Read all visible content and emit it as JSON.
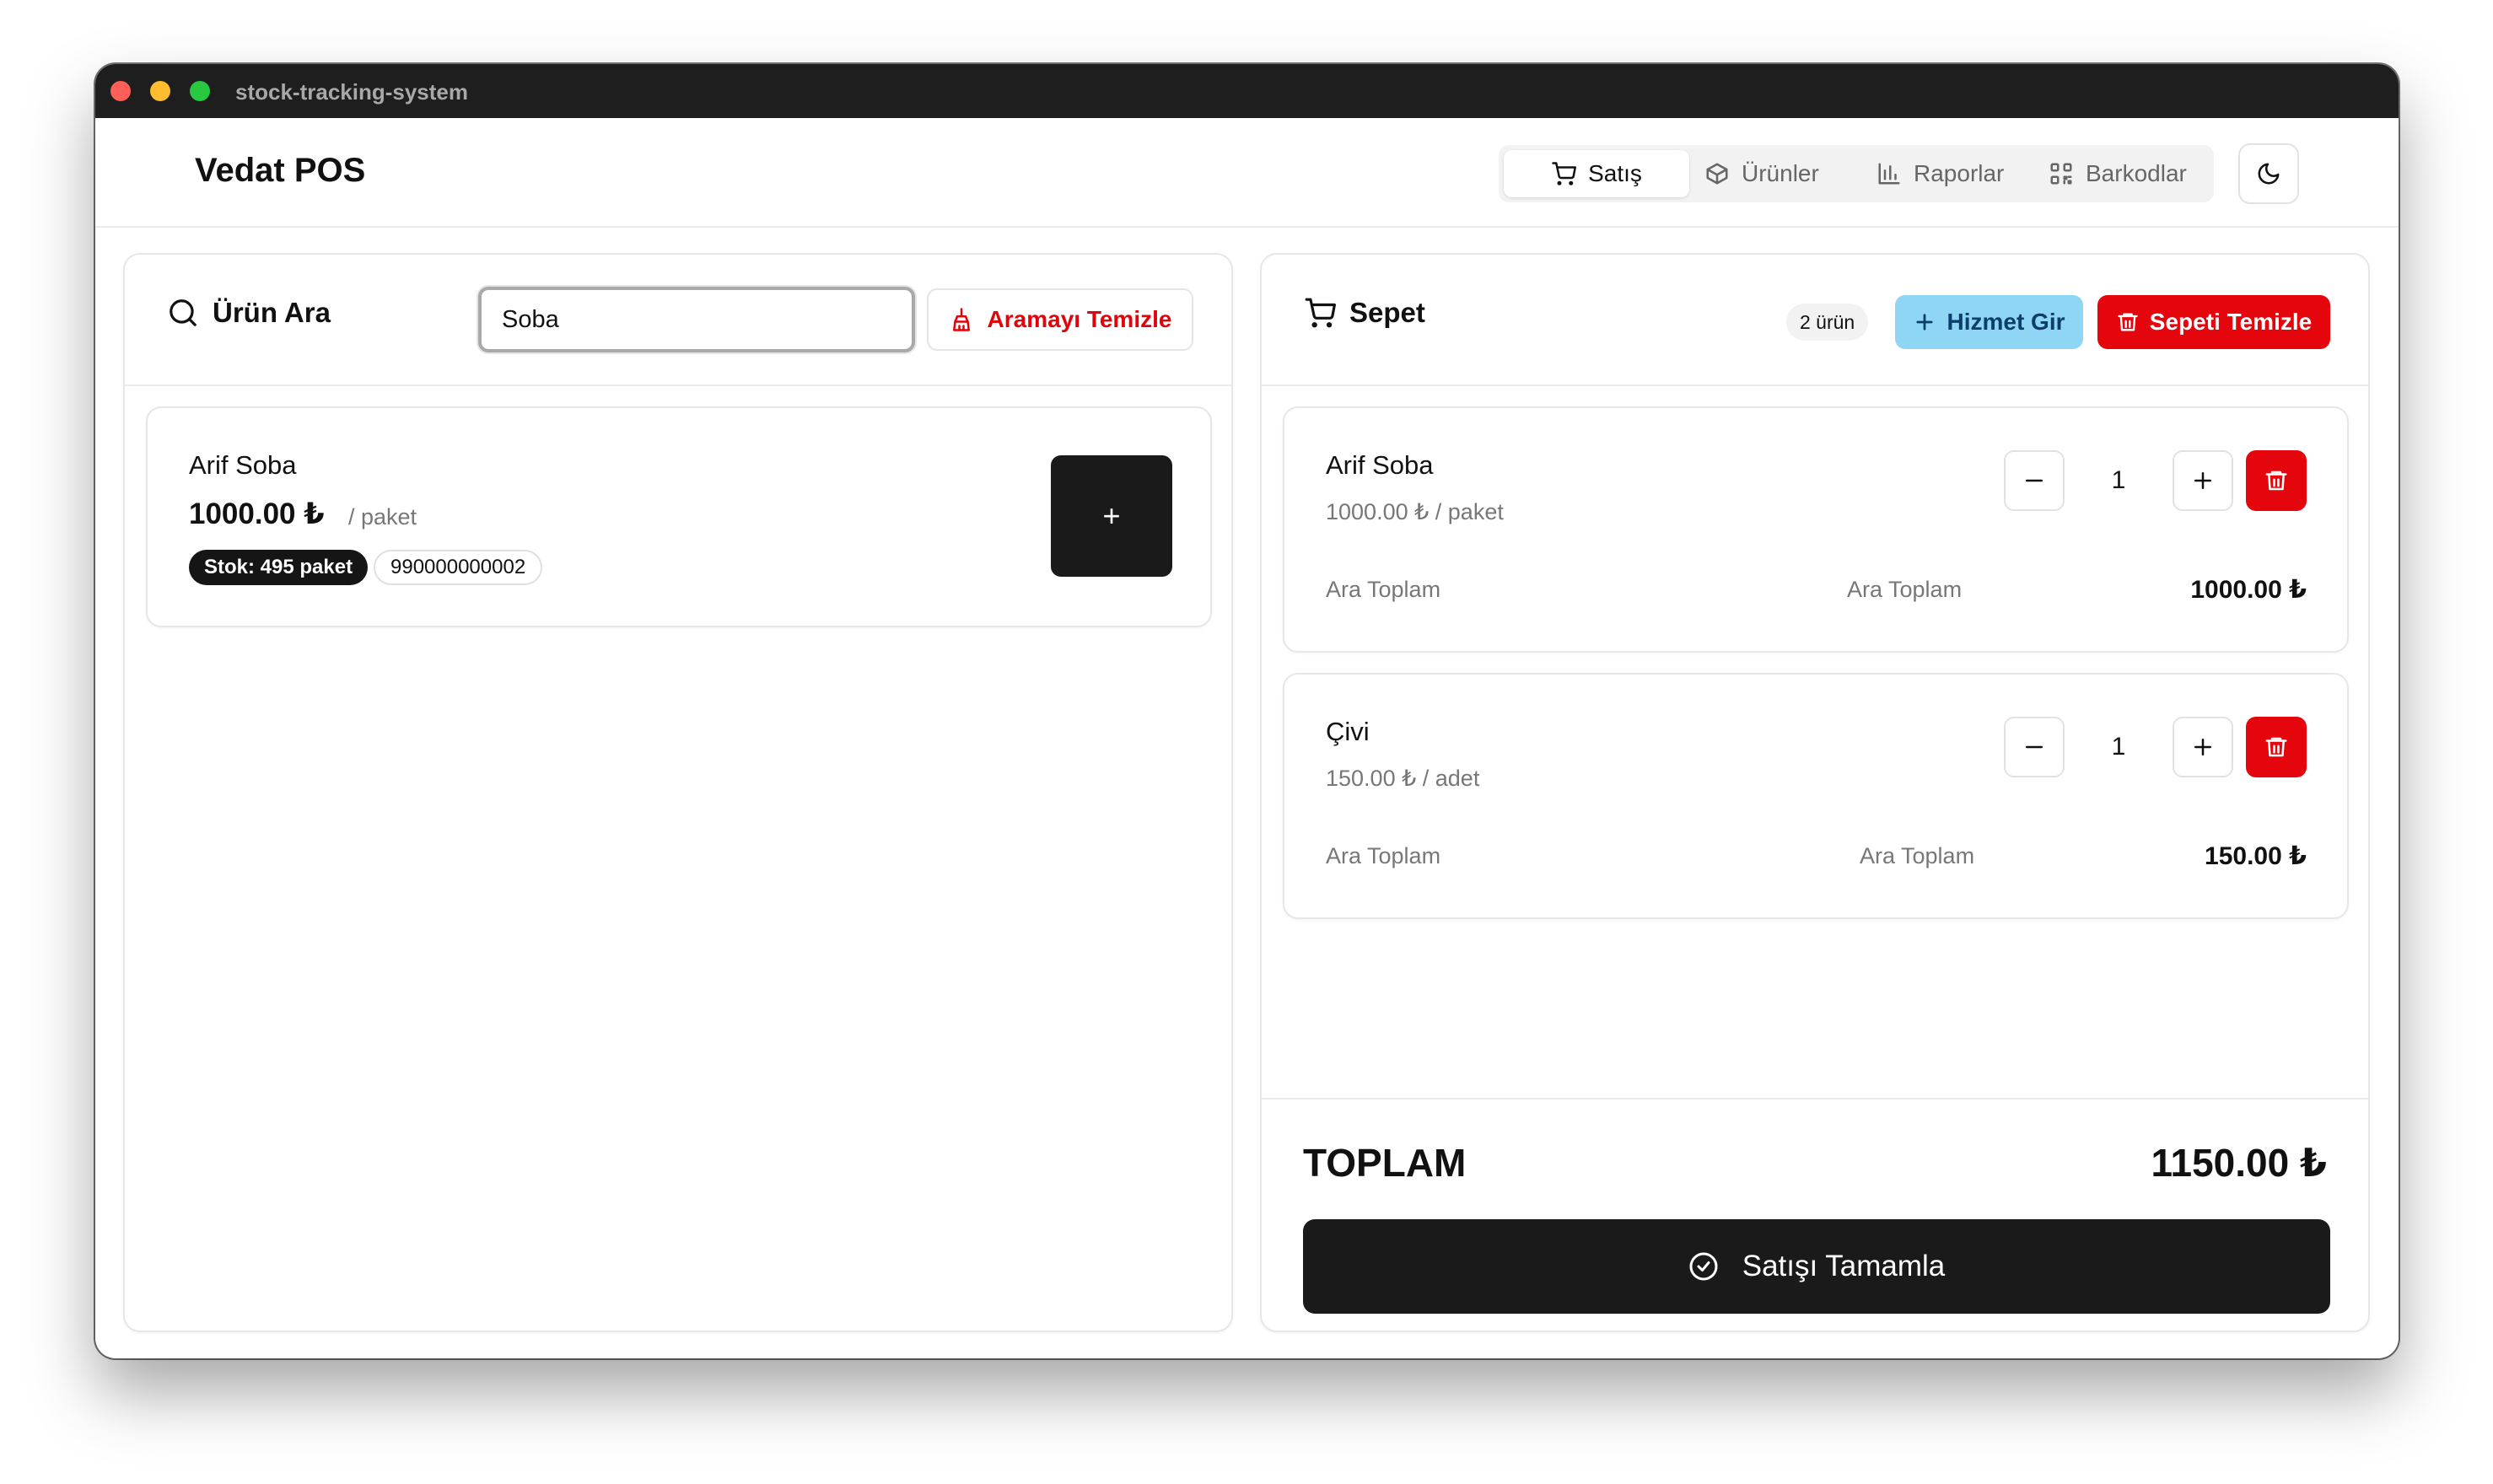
{
  "window": {
    "title": "stock-tracking-system"
  },
  "header": {
    "brand": "Vedat POS",
    "nav": [
      {
        "label": "Satış",
        "icon": "cart-icon",
        "active": true
      },
      {
        "label": "Ürünler",
        "icon": "box-icon",
        "active": false
      },
      {
        "label": "Raporlar",
        "icon": "bar-chart-icon",
        "active": false
      },
      {
        "label": "Barkodlar",
        "icon": "qr-code-icon",
        "active": false
      }
    ],
    "theme_icon": "moon-icon"
  },
  "search": {
    "title": "Ürün Ara",
    "value": "Soba",
    "clear_label": "Aramayı Temizle"
  },
  "results": [
    {
      "name": "Arif Soba",
      "price": "1000.00 ₺",
      "unit": "/ paket",
      "stock": "Stok: 495 paket",
      "barcode": "990000000002",
      "add_label": "+"
    }
  ],
  "cart": {
    "title": "Sepet",
    "count": "2 ürün",
    "service_label": "Hizmet Gir",
    "clear_label": "Sepeti Temizle",
    "items": [
      {
        "name": "Arif Soba",
        "unit_price": "1000.00 ₺ / paket",
        "qty": "1",
        "subtotal_label": "Ara Toplam",
        "subtotal_label_2": "Ara Toplam",
        "subtotal": "1000.00 ₺"
      },
      {
        "name": "Çivi",
        "unit_price": "150.00 ₺ / adet",
        "qty": "1",
        "subtotal_label": "Ara Toplam",
        "subtotal_label_2": "Ara Toplam",
        "subtotal": "150.00 ₺"
      }
    ],
    "total_label": "TOPLAM",
    "total_value": "1150.00 ₺",
    "complete_label": "Satışı Tamamla"
  },
  "colors": {
    "accent_dark": "#1a1a1a",
    "danger": "#e5050c",
    "info": "#8fd6f5"
  }
}
